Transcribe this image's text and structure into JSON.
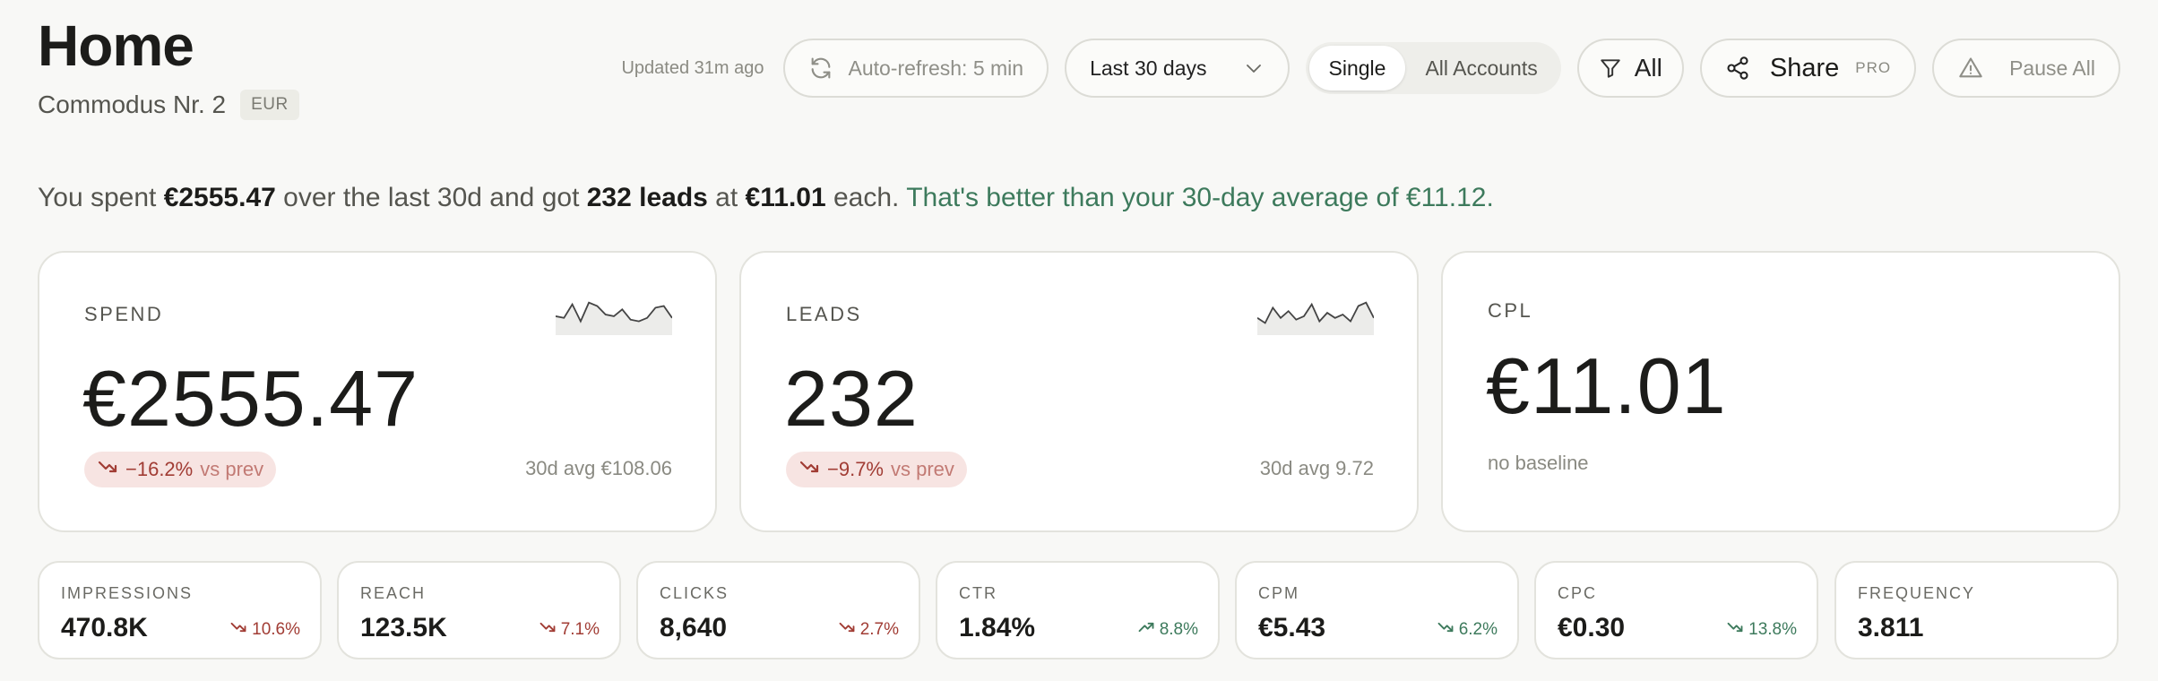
{
  "header": {
    "title": "Home",
    "account_name": "Commodus Nr. 2",
    "currency": "EUR"
  },
  "toolbar": {
    "updated": "Updated 31m ago",
    "auto_refresh": "Auto-refresh: 5 min",
    "date_range": "Last 30 days",
    "segment": [
      "Single",
      "All Accounts"
    ],
    "segment_active": "Single",
    "filter": "All",
    "share": "Share",
    "pro": "PRO",
    "pause": "Pause All"
  },
  "summary": {
    "p1": "You spent ",
    "spent": "€2555.47",
    "p2": " over the last 30d and got ",
    "leads": "232 leads",
    "p3": " at ",
    "cpl": "€11.01",
    "p4": " each. ",
    "verdict": "That's better than your 30-day average of €11.12."
  },
  "cards": {
    "spend": {
      "label": "SPEND",
      "value": "€2555.47",
      "delta": "−16.2%",
      "vs": "vs prev",
      "avg": "30d avg €108.06",
      "spark": [
        0.55,
        0.6,
        0.2,
        0.7,
        0.15,
        0.25,
        0.5,
        0.55,
        0.35,
        0.65,
        0.7,
        0.6,
        0.3,
        0.25,
        0.6
      ]
    },
    "leads": {
      "label": "LEADS",
      "value": "232",
      "delta": "−9.7%",
      "vs": "vs prev",
      "avg": "30d avg 9.72",
      "spark": [
        0.6,
        0.75,
        0.3,
        0.6,
        0.4,
        0.65,
        0.55,
        0.2,
        0.7,
        0.45,
        0.6,
        0.5,
        0.7,
        0.25,
        0.15,
        0.6
      ]
    },
    "cpl": {
      "label": "CPL",
      "value": "€11.01",
      "baseline": "no baseline"
    }
  },
  "metrics": [
    {
      "label": "IMPRESSIONS",
      "value": "470.8K",
      "delta": "10.6%",
      "trend": "down",
      "tone": "bad"
    },
    {
      "label": "REACH",
      "value": "123.5K",
      "delta": "7.1%",
      "trend": "down",
      "tone": "bad"
    },
    {
      "label": "CLICKS",
      "value": "8,640",
      "delta": "2.7%",
      "trend": "down",
      "tone": "bad"
    },
    {
      "label": "CTR",
      "value": "1.84%",
      "delta": "8.8%",
      "trend": "up",
      "tone": "good"
    },
    {
      "label": "CPM",
      "value": "€5.43",
      "delta": "6.2%",
      "trend": "down",
      "tone": "good"
    },
    {
      "label": "CPC",
      "value": "€0.30",
      "delta": "13.8%",
      "trend": "down",
      "tone": "good"
    },
    {
      "label": "FREQUENCY",
      "value": "3.811",
      "delta": "",
      "trend": "",
      "tone": ""
    }
  ],
  "icons": {
    "refresh": "refresh-icon",
    "chevron": "chevron-down-icon",
    "filter": "filter-icon",
    "share": "share-icon",
    "warning": "warning-icon",
    "trend_down": "trend-down-icon",
    "trend_up": "trend-up-icon"
  },
  "colors": {
    "background": "#f8f8f6",
    "negative": "#a13c34",
    "negative_bg": "#f7e4e2",
    "positive": "#3d7a5c"
  }
}
